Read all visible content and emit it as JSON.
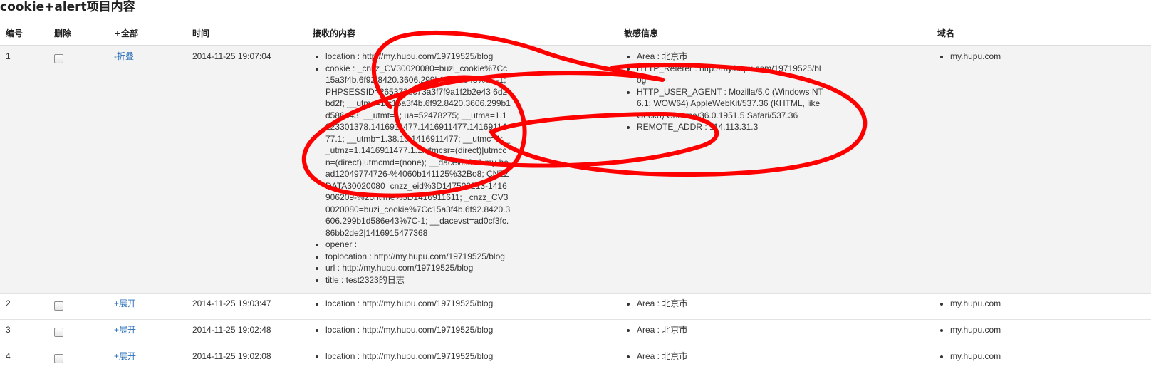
{
  "page": {
    "title": "cookie+alert项目内容"
  },
  "headers": {
    "id": "编号",
    "delete": "删除",
    "toggle_all": "+全部",
    "time": "时间",
    "content": "接收的内容",
    "sensitive": "敏感信息",
    "domain": "域名"
  },
  "rows": [
    {
      "id": "1",
      "toggle": "-折叠",
      "time": "2014-11-25 19:07:04",
      "content": [
        "location : http://my.hupu.com/19719525/blog",
        "cookie : _cnzz_CV30020080=buzi_cookie%7Cc15a3f4b.6f92.8420.3606.299b1d586e43%7C-1; PHPSESSID=265373ec73a3f7f9a1f2b2e43 6d2bd2f; __utma=1.c15a3f4b.6f92.8420.3606.299b1d586e43; __utmt=1; ua=52478275; __utma=1.1223301378.1416911477.1416911477.1416911477.1; __utmb=1.38.10.1416911477; __utmc=1; __utmz=1.1416911477.1.1.utmcsr=(direct)|utmccn=(direct)|utmcmd=(none); __dacevid3=1.my-head12049774726-%4060b141125%32Bo8; CNZZDATA30020080=cnzz_eid%3D147500213-1416906209-%26ntime%3D1416911611; _cnzz_CV30020080=buzi_cookie%7Cc15a3f4b.6f92.8420.3606.299b1d586e43%7C-1; __dacevst=ad0cf3fc.86bb2de2|1416915477368",
        "opener :",
        "toplocation : http://my.hupu.com/19719525/blog",
        "url : http://my.hupu.com/19719525/blog",
        "title : test2323的日志"
      ],
      "sensitive": [
        "Area : 北京市",
        "HTTP_Referer : http://my.hupu.com/19719525/blog",
        "HTTP_USER_AGENT : Mozilla/5.0 (Windows NT 6.1; WOW64) AppleWebKit/537.36 (KHTML, like Gecko) Chrome/36.0.1951.5 Safari/537.36",
        "REMOTE_ADDR : 114.113.31.3"
      ],
      "domain": "my.hupu.com"
    },
    {
      "id": "2",
      "toggle": "+展开",
      "time": "2014-11-25 19:03:47",
      "content": [
        "location : http://my.hupu.com/19719525/blog"
      ],
      "sensitive": [
        "Area : 北京市"
      ],
      "domain": "my.hupu.com"
    },
    {
      "id": "3",
      "toggle": "+展开",
      "time": "2014-11-25 19:02:48",
      "content": [
        "location : http://my.hupu.com/19719525/blog"
      ],
      "sensitive": [
        "Area : 北京市"
      ],
      "domain": "my.hupu.com"
    },
    {
      "id": "4",
      "toggle": "+展开",
      "time": "2014-11-25 19:02:08",
      "content": [
        "location : http://my.hupu.com/19719525/blog"
      ],
      "sensitive": [
        "Area : 北京市"
      ],
      "domain": "my.hupu.com"
    }
  ],
  "colors": {
    "link": "#2a6fb8",
    "expanded_row_bg": "#f3f3f3",
    "annotation": "#ff0000"
  }
}
